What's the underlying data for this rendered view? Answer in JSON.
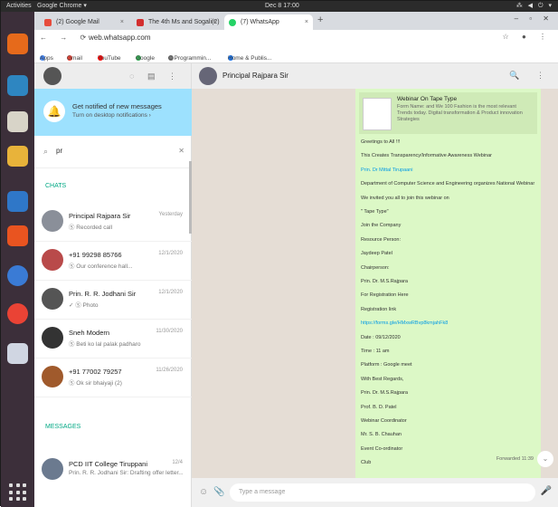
{
  "os": {
    "activities": "Activities",
    "app": "Google Chrome ▾",
    "clock": "Dec 8  17:00",
    "tray": "⁂ ◀ ⏻ ▾"
  },
  "browser": {
    "tabs": [
      {
        "label": "(2) Google Mail",
        "color": "#e74c3c"
      },
      {
        "label": "The 4th Ms and Sogali(2)",
        "color": "#d32f2f"
      },
      {
        "label": "(7) WhatsApp",
        "color": "#25d366"
      }
    ],
    "new_tab": "+",
    "window_controls": "– ▫ ✕",
    "nav": "← → ⟳",
    "url": "web.whatsapp.com",
    "tools": "☆ ● ⋮",
    "bookmarks": [
      "Apps",
      "Gmail",
      "YouTube",
      "Google",
      "C Programmin...",
      "Home & Publis..."
    ]
  },
  "sidebar": {
    "header_icons": "◌ ▤ ⋮",
    "notification": {
      "bell": "🔔",
      "title": "Get notified of new messages",
      "subtitle": "Turn on desktop notifications ›"
    },
    "search": {
      "icon": "search-icon",
      "value": "pr",
      "clear": "✕"
    },
    "chats_label": "CHATS",
    "messages_label": "MESSAGES",
    "chats": [
      {
        "name": "Principal Rajpara Sir",
        "message": "Ⓢ Recorded call",
        "time": "Yesterday",
        "avatar": "#8a8f99"
      },
      {
        "name": "+91 99298 85766",
        "message": "Ⓢ Our conference hall...",
        "time": "12/1/2020",
        "avatar": "#b94a4a"
      },
      {
        "name": "Prin. R. R. Jodhani Sir",
        "message": "✓ Ⓢ Photo",
        "time": "12/1/2020",
        "avatar": "#555"
      },
      {
        "name": "Sneh Modern",
        "message": "Ⓢ Beti ko lal palak padharo",
        "time": "11/30/2020",
        "avatar": "#333"
      },
      {
        "name": "+91 77002 79257",
        "message": "Ⓢ Ok sir bhaiyaji (2)",
        "time": "11/26/2020",
        "avatar": "#a05a2c"
      }
    ],
    "message_result": {
      "name": "PCD IIT College Tiruppani",
      "message": "Prin. R. R. Jodhani Sir: Drafting offer letter...",
      "time": "12/4",
      "avatar": "#6b7a8f"
    }
  },
  "conversation": {
    "title": "Principal Rajpara Sir",
    "header_icons": "🔍 ⋮",
    "link_preview": {
      "title": "Webinar On Tape Type",
      "description": "Form Name: and We 100 Fashion is the most relevant Trends today. Digital transformation & Product innovation Strategies"
    },
    "lines": [
      {
        "text": "Greetings to All !!!",
        "link": false
      },
      {
        "text": "This Creates Transparency/Informative Awareness Webinar",
        "link": false
      },
      {
        "text": "Prin. Dr Mittal Tirupaani",
        "link": true
      },
      {
        "text": "Department of Computer Science and Engineering organizes National Webinar",
        "link": false
      },
      {
        "text": "We invited you all to join this webinar on",
        "link": false
      },
      {
        "text": "\" Tape Type\"",
        "link": false
      },
      {
        "text": "Join the Company",
        "link": false
      },
      {
        "text": "Resource Person:",
        "link": false
      },
      {
        "text": "Jaydeep Patel",
        "link": false
      },
      {
        "text": "Chairperson:",
        "link": false
      },
      {
        "text": "Prin. Dr. M.S.Rajpara",
        "link": false
      },
      {
        "text": "For Registration Here",
        "link": false
      },
      {
        "text": "Registration link",
        "link": false
      },
      {
        "text": "https://forms.gle/HMxwRBvp8kmjahFk8",
        "link": true
      },
      {
        "text": "Date : 09/12/2020",
        "link": false
      },
      {
        "text": "Time : 11 am",
        "link": false
      },
      {
        "text": "Platform : Google meet",
        "link": false
      },
      {
        "text": "With Best Regards,",
        "link": false
      },
      {
        "text": "Prin. Dr. M.S.Rajpara",
        "link": false
      },
      {
        "text": "Prof. B. D. Patel",
        "link": false
      },
      {
        "text": "Webinar Coordinator",
        "link": false
      },
      {
        "text": "Mr. S. B. Chauhan",
        "link": false
      },
      {
        "text": "Event Co-ordinator",
        "link": false
      },
      {
        "text": "Club",
        "link": false
      }
    ],
    "forwarded_time": "Forwarded 11:39",
    "scroll_down": "⌄",
    "composer": {
      "emoji": "☺",
      "attach": "📎",
      "placeholder": "Type a message",
      "mic": "🎤"
    }
  }
}
